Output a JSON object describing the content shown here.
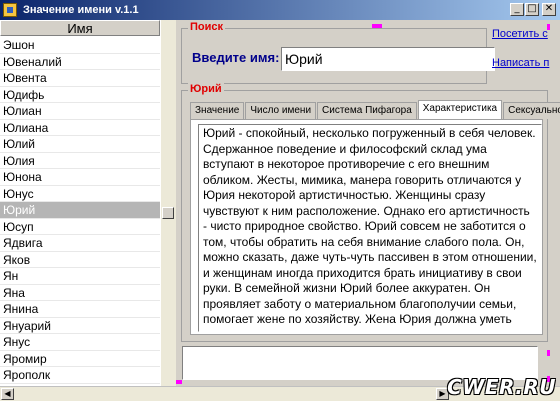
{
  "window": {
    "title": "Значение имени v.1.1",
    "buttons": {
      "minimize": "_",
      "maximize": "□",
      "close": "✕"
    }
  },
  "name_list": {
    "header": "Имя",
    "items": [
      "Эшон",
      "Ювеналий",
      "Ювента",
      "Юдифь",
      "Юлиан",
      "Юлиана",
      "Юлий",
      "Юлия",
      "Юнона",
      "Юнус",
      "Юрий",
      "Юсуп",
      "Ядвига",
      "Яков",
      "Ян",
      "Яна",
      "Янина",
      "Януарий",
      "Янус",
      "Яромир",
      "Ярополк"
    ],
    "selected_index": 10
  },
  "search": {
    "group_title": "Поиск",
    "label": "Введите имя:",
    "value": "Юрий"
  },
  "links": {
    "visit": "Посетить с",
    "write": "Написать п"
  },
  "info": {
    "group_title": "Юрий",
    "tabs": [
      "Значение",
      "Число имени",
      "Система Пифагора",
      "Характеристика",
      "Сексуальность"
    ],
    "active_tab": 3,
    "text": "Юрий - спокойный, несколько погруженный в себя человек. Сдержанное поведение и философский склад ума вступают в некоторое противоречие с его внешним обликом. Жесты, мимика, манера говорить отличаются у Юрия некоторой артистичностью. Женщины сразу чувствуют к ним расположение. Однако его артистичность - чисто природное свойство. Юрий совсем не заботится о том, чтобы обратить на себя внимание слабого пола. Он, можно сказать, даже чуть-чуть пассивен в этом отношении, и женщинам иногда приходится брать инициативу в свои руки. В семейной жизни Юрий более аккуратен. Он проявляет заботу о материальном благополучии семьи, помогает жене по хозяйству. Жена Юрия должна уметь поддерживать ровные отношения с его матерью; он чтит ее до глубокой старости. Счастье в браке обретает, как правило, с Азой, Алевтиной,"
  },
  "watermark": "CWER.RU",
  "colors": {
    "titlebar": "#0a246a",
    "accent_red": "#e00000",
    "label_blue": "#00008b",
    "marker": "#ff00ff"
  },
  "icons": {
    "app": "app-icon",
    "scroll_left": "arrow-left-icon",
    "scroll_right": "arrow-right-icon"
  }
}
